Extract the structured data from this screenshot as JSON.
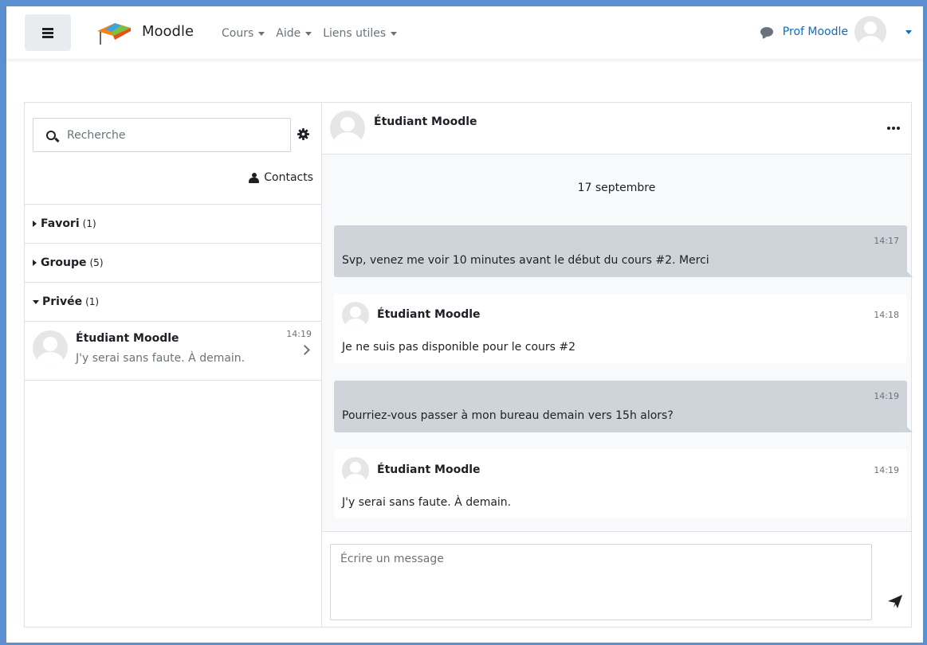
{
  "navbar": {
    "brand": "Moodle",
    "menu": [
      {
        "label": "Cours"
      },
      {
        "label": "Aide"
      },
      {
        "label": "Liens utiles"
      }
    ],
    "user_name": "Prof Moodle"
  },
  "sidebar": {
    "search_placeholder": "Recherche",
    "contacts_label": "Contacts",
    "sections": [
      {
        "label": "Favori",
        "count": "(1)",
        "expanded": false
      },
      {
        "label": "Groupe",
        "count": "(5)",
        "expanded": false
      },
      {
        "label": "Privée",
        "count": "(1)",
        "expanded": true
      }
    ],
    "conversation": {
      "name": "Étudiant Moodle",
      "preview": "J'y serai sans faute. À demain.",
      "time": "14:19"
    }
  },
  "chat": {
    "contact_name": "Étudiant Moodle",
    "date": "17 septembre",
    "messages": [
      {
        "type": "sent",
        "time": "14:17",
        "text": "Svp, venez me voir 10 minutes avant le début du cours #2. Merci"
      },
      {
        "type": "received",
        "sender": "Étudiant Moodle",
        "time": "14:18",
        "text": "Je ne suis pas disponible pour le cours #2"
      },
      {
        "type": "sent",
        "time": "14:19",
        "text": "Pourriez-vous passer à mon bureau demain vers 15h alors?"
      },
      {
        "type": "received",
        "sender": "Étudiant Moodle",
        "time": "14:19",
        "text": "J'y serai sans faute. À demain."
      }
    ],
    "composer_placeholder": "Écrire un message"
  },
  "colors": {
    "frame_border": "#5b8fd1",
    "link": "#0f6cbf",
    "sent_bubble": "#ced4da",
    "muted_text": "#6a737b"
  }
}
